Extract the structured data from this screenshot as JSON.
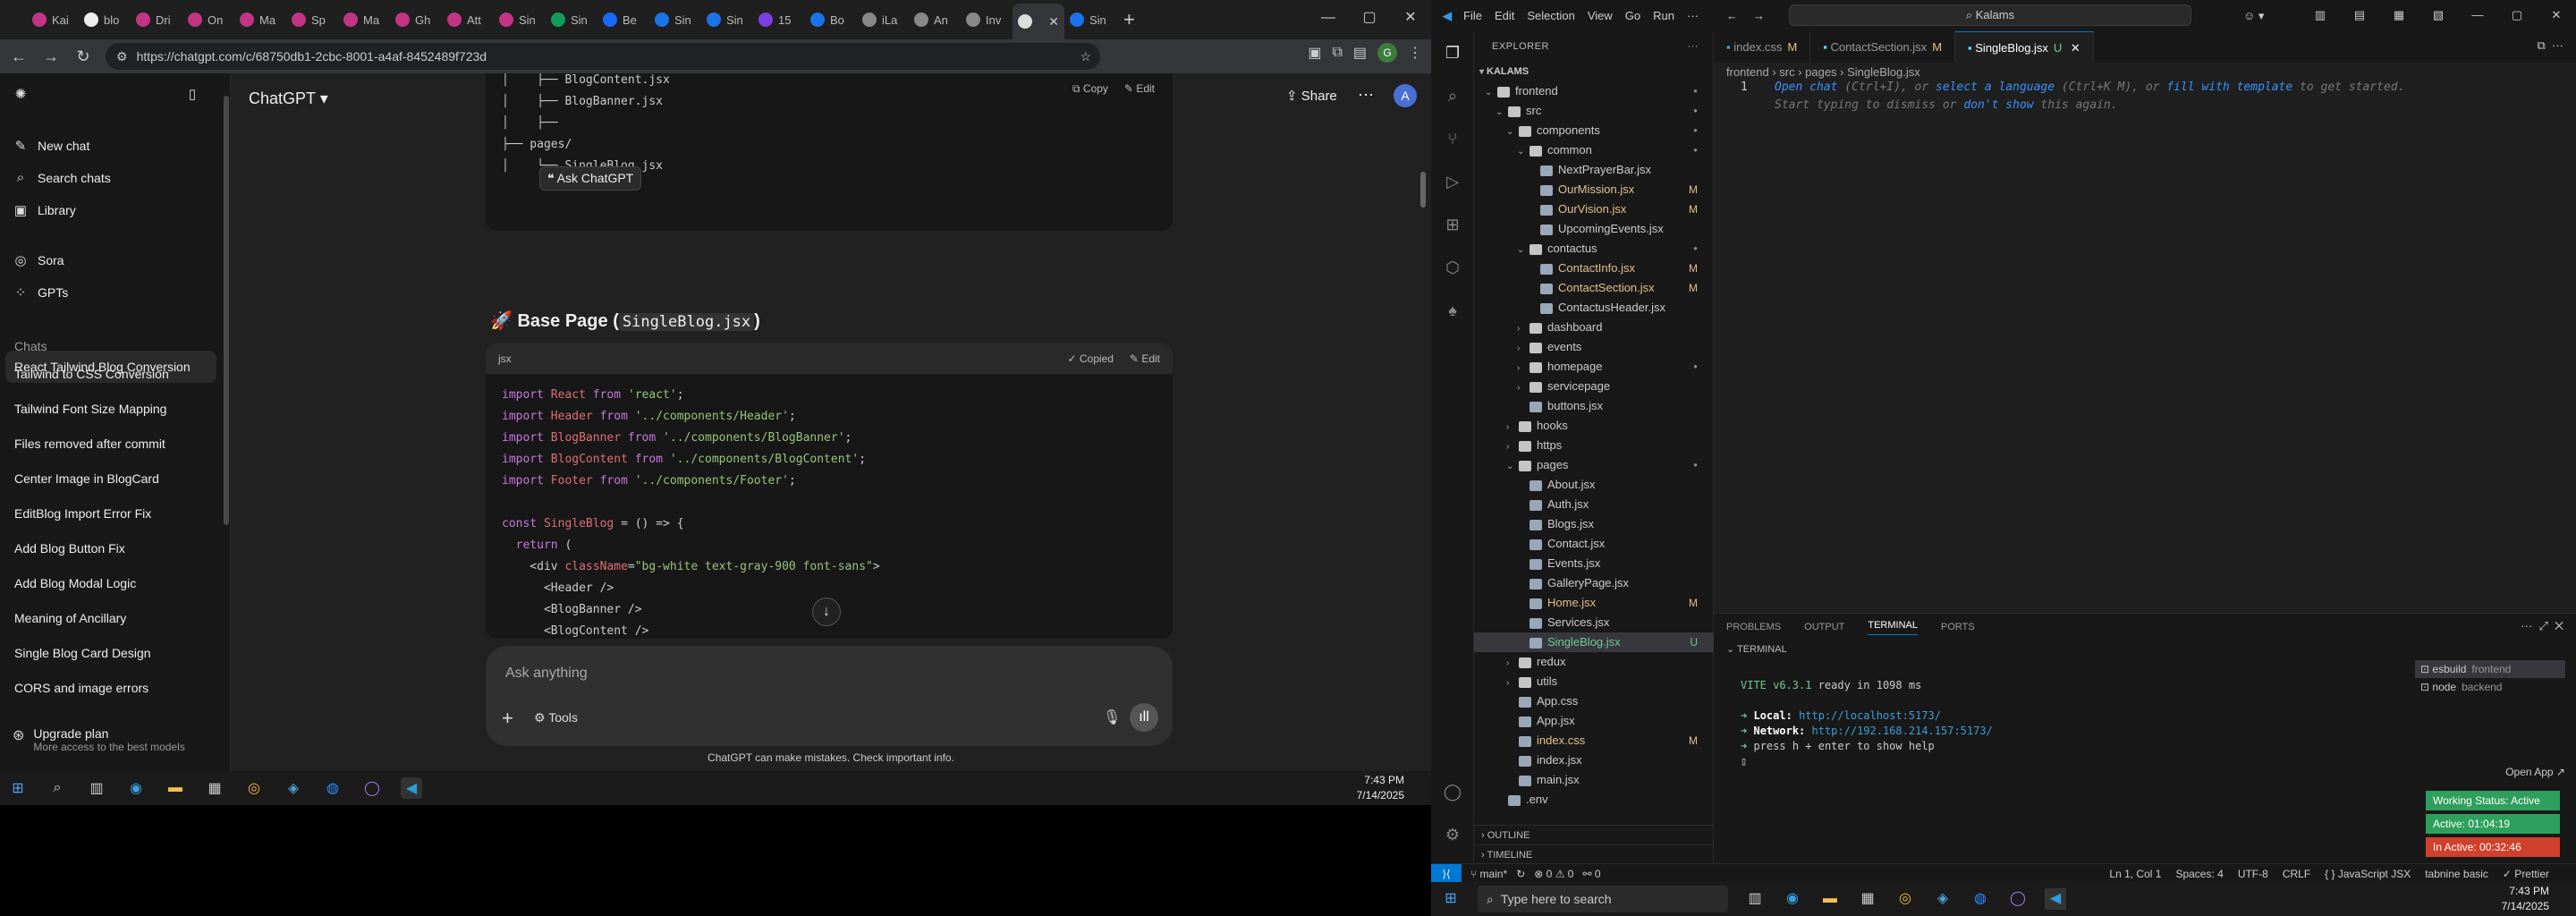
{
  "chrome": {
    "tabs": [
      {
        "label": "Kai",
        "color": "#c13584"
      },
      {
        "label": "blo",
        "color": "#eee"
      },
      {
        "label": "Dri",
        "color": "#c13584"
      },
      {
        "label": "On",
        "color": "#c13584"
      },
      {
        "label": "Ma",
        "color": "#c13584"
      },
      {
        "label": "Sp",
        "color": "#c13584"
      },
      {
        "label": "Ma",
        "color": "#c13584"
      },
      {
        "label": "Gh",
        "color": "#c13584"
      },
      {
        "label": "Att",
        "color": "#c13584"
      },
      {
        "label": "Sin",
        "color": "#c13584"
      },
      {
        "label": "Sin",
        "color": "#0f9d58"
      },
      {
        "label": "Be",
        "color": "#1769ff"
      },
      {
        "label": "Sin",
        "color": "#1a73e8"
      },
      {
        "label": "Sin",
        "color": "#1a73e8"
      },
      {
        "label": "15",
        "color": "#7b3fe4"
      },
      {
        "label": "Bo",
        "color": "#1a73e8"
      },
      {
        "label": "iLa",
        "color": "#888"
      },
      {
        "label": "An",
        "color": "#888"
      },
      {
        "label": "Inv",
        "color": "#888"
      },
      {
        "label": "",
        "color": "#ddd",
        "active": true
      },
      {
        "label": "Sin",
        "color": "#1a73e8"
      }
    ],
    "url": "https://chatgpt.com/c/68750db1-2cbc-8001-a4af-8452489f723d",
    "profile_initial": "G"
  },
  "gpt": {
    "sidebar": {
      "new_chat": "New chat",
      "search": "Search chats",
      "library": "Library",
      "sora": "Sora",
      "gpts": "GPTs",
      "chats_title": "Chats",
      "chats": [
        "React Tailwind Blog Conversion",
        "Tailwind to CSS Conversion",
        "Tailwind Font Size Mapping",
        "Files removed after commit",
        "Center Image in BlogCard",
        "EditBlog Import Error Fix",
        "Add Blog Button Fix",
        "Add Blog Modal Logic",
        "Meaning of Ancillary",
        "Single Blog Card Design",
        "CORS and image errors"
      ],
      "upgrade_title": "Upgrade plan",
      "upgrade_sub": "More access to the best models"
    },
    "header": {
      "model": "ChatGPT ▾",
      "share": "Share",
      "avatar": "A"
    },
    "tree": {
      "line1": "│    ├── BlogContent.jsx",
      "line2": "│    ├── BlogBanner.jsx",
      "line3": "│    ├──",
      "line4": "├── pages/",
      "line5": "│    └── SingleBlog.jsx",
      "copy": "Copy",
      "edit": "Edit",
      "ask_chip": "Ask ChatGPT"
    },
    "heading_prefix": "🚀 Base Page (",
    "heading_code": "SingleBlog.jsx",
    "heading_suffix": ")",
    "code": {
      "lang": "jsx",
      "copied": "Copied",
      "edit": "Edit"
    },
    "ask_placeholder": "Ask anything",
    "tools": "Tools",
    "disclaimer": "ChatGPT can make mistakes. Check important info."
  },
  "left_clock": {
    "time": "7:43 PM",
    "date": "7/14/2025"
  },
  "vscode": {
    "menu": [
      "File",
      "Edit",
      "Selection",
      "View",
      "Go",
      "Run",
      "···"
    ],
    "search": "Kalams",
    "explorer_title": "EXPLORER",
    "root": "KALAMS",
    "tree": [
      {
        "d": 1,
        "t": "folder",
        "n": "frontend",
        "open": true,
        "dot": true
      },
      {
        "d": 2,
        "t": "folder",
        "n": "src",
        "open": true,
        "dot": true
      },
      {
        "d": 3,
        "t": "folder",
        "n": "components",
        "open": true,
        "dot": true
      },
      {
        "d": 4,
        "t": "folder",
        "n": "common",
        "open": true,
        "dot": true
      },
      {
        "d": 5,
        "t": "file",
        "n": "NextPrayerBar.jsx"
      },
      {
        "d": 5,
        "t": "file",
        "n": "OurMission.jsx",
        "s": "M"
      },
      {
        "d": 5,
        "t": "file",
        "n": "OurVision.jsx",
        "s": "M"
      },
      {
        "d": 5,
        "t": "file",
        "n": "UpcomingEvents.jsx"
      },
      {
        "d": 4,
        "t": "folder",
        "n": "contactus",
        "open": true,
        "dot": true
      },
      {
        "d": 5,
        "t": "file",
        "n": "ContactInfo.jsx",
        "s": "M"
      },
      {
        "d": 5,
        "t": "file",
        "n": "ContactSection.jsx",
        "s": "M"
      },
      {
        "d": 5,
        "t": "file",
        "n": "ContactusHeader.jsx"
      },
      {
        "d": 4,
        "t": "folder",
        "n": "dashboard"
      },
      {
        "d": 4,
        "t": "folder",
        "n": "events"
      },
      {
        "d": 4,
        "t": "folder",
        "n": "homepage",
        "dot": true
      },
      {
        "d": 4,
        "t": "folder",
        "n": "servicepage"
      },
      {
        "d": 4,
        "t": "file",
        "n": "buttons.jsx"
      },
      {
        "d": 3,
        "t": "folder",
        "n": "hooks"
      },
      {
        "d": 3,
        "t": "folder",
        "n": "https"
      },
      {
        "d": 3,
        "t": "folder",
        "n": "pages",
        "open": true,
        "dot": true
      },
      {
        "d": 4,
        "t": "file",
        "n": "About.jsx"
      },
      {
        "d": 4,
        "t": "file",
        "n": "Auth.jsx"
      },
      {
        "d": 4,
        "t": "file",
        "n": "Blogs.jsx"
      },
      {
        "d": 4,
        "t": "file",
        "n": "Contact.jsx"
      },
      {
        "d": 4,
        "t": "file",
        "n": "Events.jsx"
      },
      {
        "d": 4,
        "t": "file",
        "n": "GalleryPage.jsx"
      },
      {
        "d": 4,
        "t": "file",
        "n": "Home.jsx",
        "s": "M"
      },
      {
        "d": 4,
        "t": "file",
        "n": "Services.jsx"
      },
      {
        "d": 4,
        "t": "file",
        "n": "SingleBlog.jsx",
        "s": "U",
        "sel": true
      },
      {
        "d": 3,
        "t": "folder",
        "n": "redux"
      },
      {
        "d": 3,
        "t": "folder",
        "n": "utils"
      },
      {
        "d": 3,
        "t": "file",
        "n": "App.css"
      },
      {
        "d": 3,
        "t": "file",
        "n": "App.jsx"
      },
      {
        "d": 3,
        "t": "file",
        "n": "index.css",
        "s": "M"
      },
      {
        "d": 3,
        "t": "file",
        "n": "index.jsx"
      },
      {
        "d": 3,
        "t": "file",
        "n": "main.jsx"
      },
      {
        "d": 2,
        "t": "file",
        "n": ".env"
      }
    ],
    "outline": "OUTLINE",
    "timeline": "TIMELINE",
    "tabs": [
      {
        "n": "index.css",
        "s": "M"
      },
      {
        "n": "ContactSection.jsx",
        "s": "M"
      },
      {
        "n": "SingleBlog.jsx",
        "s": "U",
        "on": true
      }
    ],
    "breadcrumb": "frontend › src › pages › SingleBlog.jsx",
    "line_no": "1",
    "hint_1a": "Open chat",
    "hint_1b": " (Ctrl+I), or ",
    "hint_1c": "select a language",
    "hint_1d": " (Ctrl+K M), or ",
    "hint_1e": "fill with template",
    "hint_1f": " to get started.",
    "hint_2a": "Start typing to dismiss or ",
    "hint_2b": "don't show",
    "hint_2c": " this again.",
    "panel_tabs": [
      "PROBLEMS",
      "OUTPUT",
      "TERMINAL",
      "PORTS"
    ],
    "terminal_title": "TERMINAL",
    "term": {
      "vite": "VITE v6.3.1",
      "ready": "  ready in 1098 ms",
      "local_label": "Local:",
      "local": "http://localhost:5173/",
      "network_label": "Network:",
      "network": "http://192.168.214.157:5173/",
      "help": "press h + enter to show help"
    },
    "terminals": [
      {
        "n": "esbuild",
        "sub": "frontend"
      },
      {
        "n": "node",
        "sub": "backend"
      }
    ],
    "open_app": "Open App ↗",
    "status_working": "Working Status: Active",
    "status_active": "Active: 01:04:19",
    "status_inactive": "In Active: 00:32:46",
    "status_colors": {
      "working": "#2e9f5c",
      "active": "#2e9f5c",
      "inactive": "#d0402a"
    },
    "statusbar": {
      "branch": "main*",
      "errors": "⊗ 0 ⚠ 0",
      "ports": "0",
      "position": "Ln 1, Col 1",
      "spaces": "Spaces: 4",
      "encoding": "UTF-8",
      "eol": "CRLF",
      "lang": "{ } JavaScript JSX",
      "tabnine": "tabnine basic",
      "prettier": "✓ Prettier"
    }
  },
  "right_search": "Type here to search",
  "right_clock": {
    "time": "7:43 PM",
    "date": "7/14/2025"
  }
}
